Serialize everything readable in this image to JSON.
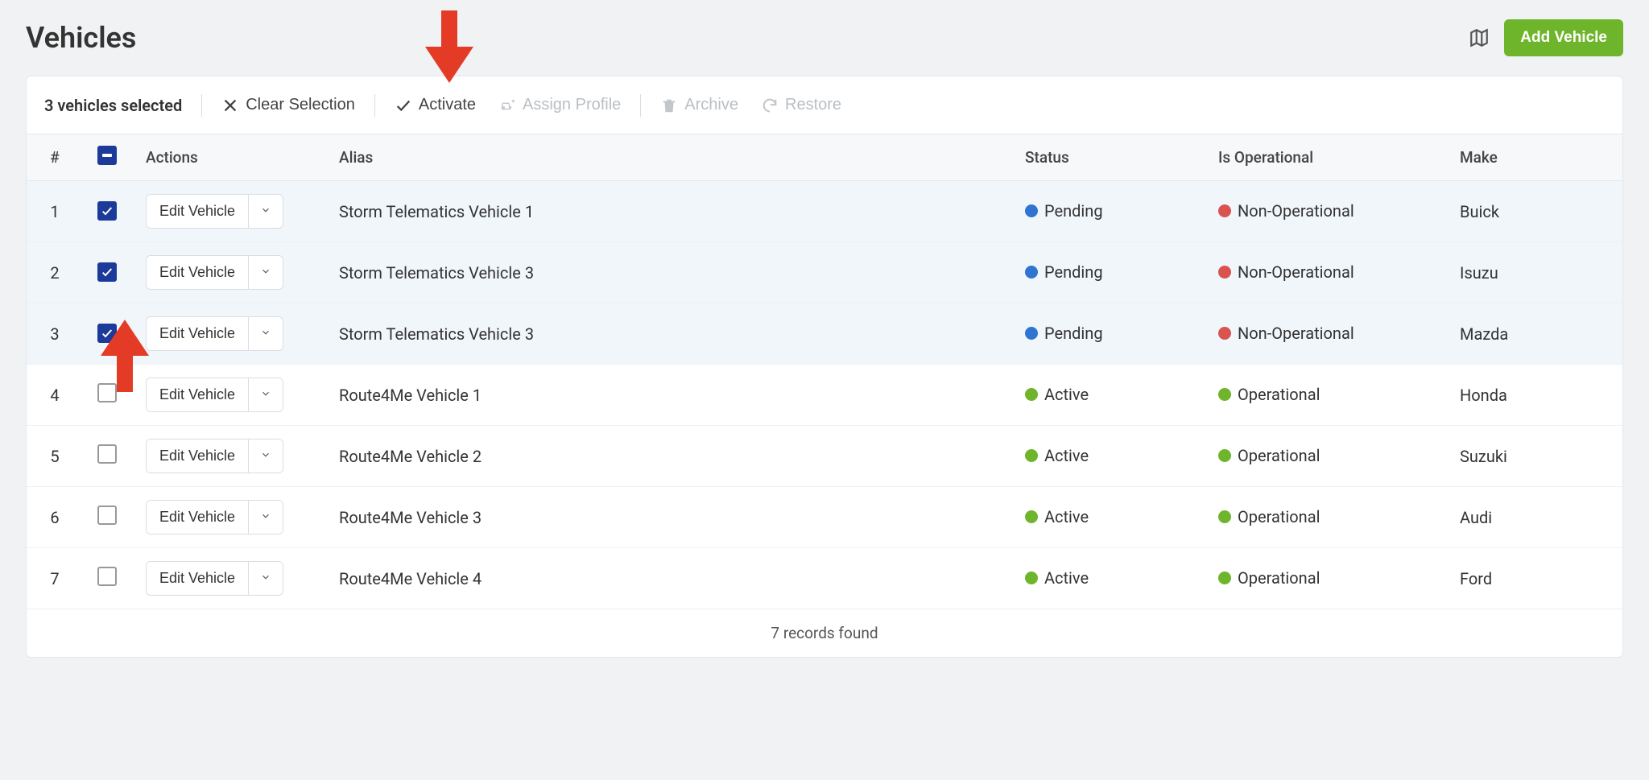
{
  "header": {
    "title": "Vehicles",
    "add_button": "Add Vehicle"
  },
  "toolbar": {
    "selected_label": "3 vehicles selected",
    "clear_label": "Clear Selection",
    "activate_label": "Activate",
    "assign_label": "Assign Profile",
    "archive_label": "Archive",
    "restore_label": "Restore"
  },
  "columns": {
    "num": "#",
    "actions": "Actions",
    "alias": "Alias",
    "status": "Status",
    "operational": "Is Operational",
    "make": "Make"
  },
  "edit_label": "Edit Vehicle",
  "rows": [
    {
      "num": "1",
      "checked": true,
      "alias": "Storm Telematics Vehicle 1",
      "status": "Pending",
      "status_color": "blue",
      "operational": "Non-Operational",
      "op_color": "red",
      "make": "Buick"
    },
    {
      "num": "2",
      "checked": true,
      "alias": "Storm Telematics Vehicle 3",
      "status": "Pending",
      "status_color": "blue",
      "operational": "Non-Operational",
      "op_color": "red",
      "make": "Isuzu"
    },
    {
      "num": "3",
      "checked": true,
      "alias": "Storm Telematics Vehicle 3",
      "status": "Pending",
      "status_color": "blue",
      "operational": "Non-Operational",
      "op_color": "red",
      "make": "Mazda"
    },
    {
      "num": "4",
      "checked": false,
      "alias": "Route4Me Vehicle 1",
      "status": "Active",
      "status_color": "green",
      "operational": "Operational",
      "op_color": "green",
      "make": "Honda"
    },
    {
      "num": "5",
      "checked": false,
      "alias": "Route4Me Vehicle 2",
      "status": "Active",
      "status_color": "green",
      "operational": "Operational",
      "op_color": "green",
      "make": "Suzuki"
    },
    {
      "num": "6",
      "checked": false,
      "alias": "Route4Me Vehicle 3",
      "status": "Active",
      "status_color": "green",
      "operational": "Operational",
      "op_color": "green",
      "make": "Audi"
    },
    {
      "num": "7",
      "checked": false,
      "alias": "Route4Me Vehicle 4",
      "status": "Active",
      "status_color": "green",
      "operational": "Operational",
      "op_color": "green",
      "make": "Ford"
    }
  ],
  "footer": "7 records found"
}
